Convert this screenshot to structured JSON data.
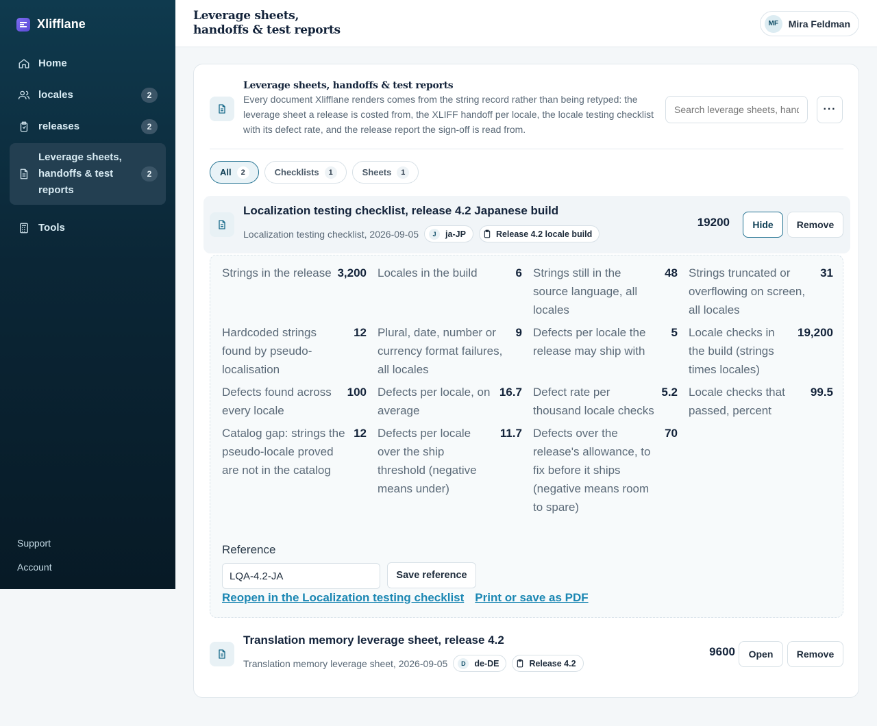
{
  "app": {
    "name": "Xlifflane"
  },
  "sidebar": {
    "items": [
      {
        "label": "Home",
        "icon": "home-icon",
        "count": null
      },
      {
        "label": "locales",
        "icon": "users-icon",
        "count": "2"
      },
      {
        "label": "releases",
        "icon": "clipboard-icon",
        "count": "2"
      },
      {
        "label": "Leverage sheets, handoffs & test reports",
        "icon": "document-icon",
        "count": "2",
        "active": true
      },
      {
        "label": "Tools",
        "icon": "calculator-icon",
        "count": null
      }
    ],
    "footer": [
      "Support",
      "Account"
    ]
  },
  "topbar": {
    "title": "Leverage sheets, handoffs & test reports",
    "user": {
      "initials": "MF",
      "name": "Mira Feldman"
    }
  },
  "main": {
    "title": "Leverage sheets, handoffs & test reports",
    "description": "Every document Xlifflane renders comes from the string record rather than being retyped: the leverage sheet a release is costed from, the XLIFF handoff per locale, the locale testing checklist with its defect rate, and the release report the sign-off is read from.",
    "search_placeholder": "Search leverage sheets, handoffs & test reports",
    "more_label": "···",
    "filters": [
      {
        "label": "All",
        "count": "2",
        "selected": true
      },
      {
        "label": "Checklists",
        "count": "1"
      },
      {
        "label": "Sheets",
        "count": "1"
      }
    ],
    "documents": [
      {
        "title": "Localization testing checklist, release 4.2 Japanese build",
        "meta": "Localization testing checklist, 2026-09-05",
        "locale_initial": "J",
        "locale": "ja-JP",
        "release": "Release 4.2 locale build",
        "amount": "19200",
        "primary_action": "Hide",
        "remove_label": "Remove",
        "stats": [
          {
            "k": "Strings in the release",
            "v": "3,200"
          },
          {
            "k": "Locales in the build",
            "v": "6"
          },
          {
            "k": "Strings still in the source language, all locales",
            "v": "48"
          },
          {
            "k": "Strings truncated or overflowing on screen, all locales",
            "v": "31"
          },
          {
            "k": "Hardcoded strings found by pseudo-localisation",
            "v": "12"
          },
          {
            "k": "Plural, date, number or currency format failures, all locales",
            "v": "9"
          },
          {
            "k": "Defects per locale the release may ship with",
            "v": "5"
          },
          {
            "k": "Locale checks in the build (strings times locales)",
            "v": "19,200"
          },
          {
            "k": "Defects found across every locale",
            "v": "100"
          },
          {
            "k": "Defects per locale, on average",
            "v": "16.7"
          },
          {
            "k": "Defect rate per thousand locale checks",
            "v": "5.2"
          },
          {
            "k": "Locale checks that passed, percent",
            "v": "99.5"
          },
          {
            "k": "Catalog gap: strings the pseudo-locale proved are not in the catalog",
            "v": "12"
          },
          {
            "k": "Defects per locale over the ship threshold (negative means under)",
            "v": "11.7"
          },
          {
            "k": "Defects over the release's allowance, to fix before it ships (negative means room to spare)",
            "v": "70"
          }
        ],
        "reference_label": "Reference",
        "reference_value": "LQA-4.2-JA",
        "save_reference": "Save reference",
        "reopen_link": "Reopen in the Localization testing checklist",
        "print_link": "Print or save as PDF"
      },
      {
        "title": "Translation memory leverage sheet, release 4.2",
        "meta": "Translation memory leverage sheet, 2026-09-05",
        "locale_initial": "D",
        "locale": "de-DE",
        "release": "Release 4.2",
        "amount": "9600",
        "primary_action": "Open",
        "remove_label": "Remove"
      }
    ]
  },
  "colors": {
    "accent": "#1f7090",
    "link": "#1b87b3",
    "sidebar_bg": "#0b2636",
    "brand": "#6a5ae6"
  }
}
